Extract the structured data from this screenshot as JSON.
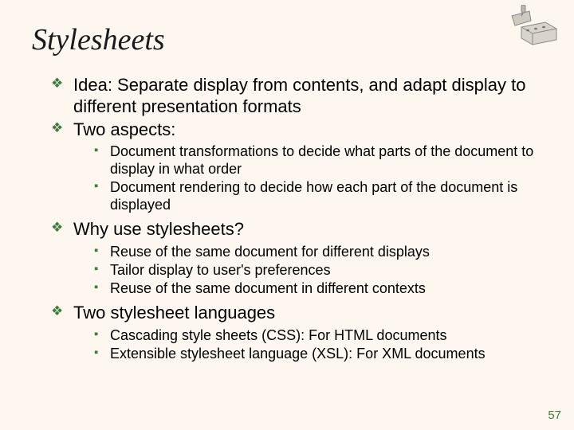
{
  "title": "Stylesheets",
  "b1": {
    "idea": "Idea: Separate display from contents, and adapt display to different presentation formats",
    "two": "Two aspects:",
    "two_sub": {
      "a": "Document transformations to decide what parts of the document to display in what order",
      "b": "Document rendering to decide how each part of the document is displayed"
    },
    "why": "Why use stylesheets?",
    "why_sub": {
      "a": "Reuse of the same document for different displays",
      "b": "Tailor display to user's preferences",
      "c": "Reuse of the same document in different contexts"
    },
    "langs": "Two stylesheet languages",
    "langs_sub": {
      "a": "Cascading style sheets (CSS): For HTML documents",
      "b": "Extensible stylesheet language (XSL): For XML documents"
    }
  },
  "page_number": "57",
  "icon": "trowel-brick-icon"
}
